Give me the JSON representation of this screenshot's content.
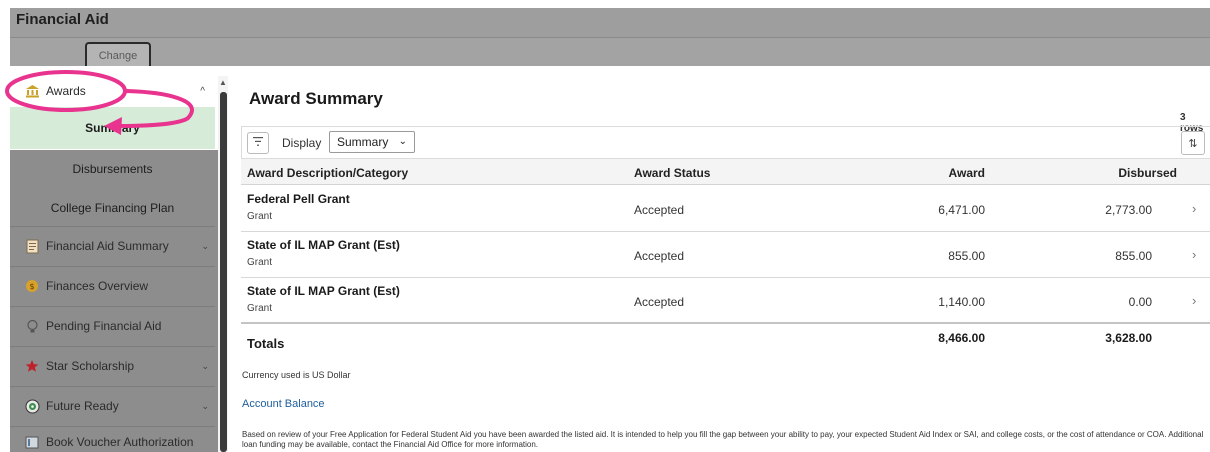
{
  "header": {
    "title": "Financial Aid",
    "change_label": "Change"
  },
  "sidebar": {
    "awards": {
      "label": "Awards",
      "children": [
        "Summary",
        "Disbursements",
        "College Financing Plan"
      ]
    },
    "items": [
      {
        "label": "Financial Aid Summary",
        "icon": "document-icon",
        "has_chevron": true
      },
      {
        "label": "Finances Overview",
        "icon": "coin-icon",
        "has_chevron": false
      },
      {
        "label": "Pending Financial Aid",
        "icon": "lightbulb-icon",
        "has_chevron": false
      },
      {
        "label": "Star Scholarship",
        "icon": "star-icon",
        "has_chevron": true
      },
      {
        "label": "Future Ready",
        "icon": "target-icon",
        "has_chevron": true
      },
      {
        "label": "Book Voucher Authorization",
        "icon": "book-icon",
        "has_chevron": false
      }
    ]
  },
  "main": {
    "title": "Award Summary",
    "rows_count": "3 rows",
    "display_label": "Display",
    "display_value": "Summary",
    "columns": [
      "Award Description/Category",
      "Award Status",
      "Award",
      "Disbursed"
    ],
    "rows": [
      {
        "description": "Federal Pell Grant",
        "category": "Grant",
        "status": "Accepted",
        "award": "6,471.00",
        "disbursed": "2,773.00"
      },
      {
        "description": "State of IL MAP Grant (Est)",
        "category": "Grant",
        "status": "Accepted",
        "award": "855.00",
        "disbursed": "855.00"
      },
      {
        "description": "State of IL MAP Grant (Est)",
        "category": "Grant",
        "status": "Accepted",
        "award": "1,140.00",
        "disbursed": "0.00"
      }
    ],
    "totals": {
      "label": "Totals",
      "award": "8,466.00",
      "disbursed": "3,628.00"
    },
    "currency_note": "Currency used is US Dollar",
    "account_balance_link": "Account Balance",
    "notice": "Based on review of your Free Application for Federal Student Aid you have been awarded the listed aid. It is intended to help you fill the gap between your ability to pay, your expected Student Aid Index or SAI, and college costs, or the cost of attendance or COA. Additional loan funding may be available, contact the Financial Aid Office for more information."
  },
  "colors": {
    "highlight_pink": "#e8348f",
    "selected_green": "#d6ecd9",
    "link_blue": "#1f5e9c",
    "header_gray": "#9e9e9e"
  }
}
